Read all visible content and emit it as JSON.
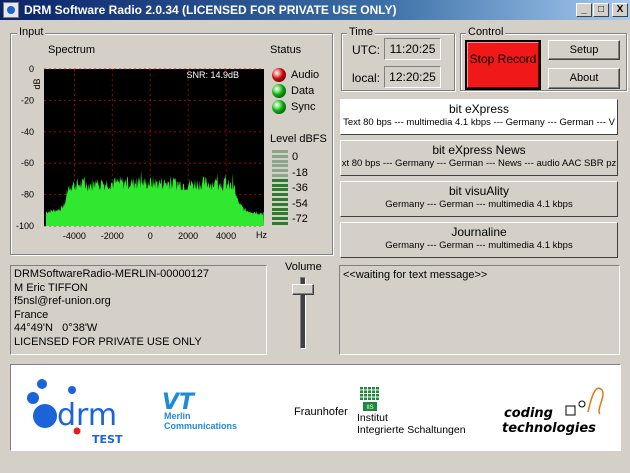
{
  "window": {
    "title": "DRM Software Radio 2.0.34 (LICENSED FOR PRIVATE USE ONLY)",
    "controls": [
      "_",
      "□",
      "X"
    ]
  },
  "input": {
    "group_label": "Input",
    "spectrum_label": "Spectrum",
    "snr_text": "SNR: 14.9dB",
    "y_unit": "dB",
    "y_ticks": [
      "0",
      "-20",
      "-40",
      "-60",
      "-80",
      "-100"
    ],
    "x_ticks": [
      "-4000",
      "-2000",
      "0",
      "2000",
      "4000"
    ],
    "x_unit": "Hz",
    "status_label": "Status",
    "status": [
      {
        "label": "Audio",
        "color": "#e01010"
      },
      {
        "label": "Data",
        "color": "#12c012"
      },
      {
        "label": "Sync",
        "color": "#12c012"
      }
    ],
    "level_label": "Level dBFS",
    "level_ticks": [
      "0",
      "-18",
      "-36",
      "-54",
      "-72"
    ]
  },
  "time": {
    "group_label": "Time",
    "utc_label": "UTC:",
    "utc_value": "11:20:25",
    "local_label": "local:",
    "local_value": "12:20:25"
  },
  "control": {
    "group_label": "Control",
    "stop_record": "Stop Record",
    "setup": "Setup",
    "about": "About"
  },
  "services": [
    {
      "name": "bit eXpress",
      "desc": "Text 80 bps --- multimedia 4.1 kbps --- Germany --- German --- V"
    },
    {
      "name": "bit eXpress News",
      "desc": "xt 80 bps --- Germany --- German --- News --- audio AAC SBR pz"
    },
    {
      "name": "bit visuAlity",
      "desc": "Germany --- German --- multimedia 4.1 kbps"
    },
    {
      "name": "Journaline",
      "desc": "Germany --- German --- multimedia 4.1 kbps"
    }
  ],
  "station_info": [
    "DRMSoftwareRadio-MERLIN-00000127",
    "M Eric TIFFON",
    "f5nsl@ref-union.org",
    "France",
    "44°49'N   0°38'W",
    "LICENSED FOR PRIVATE USE ONLY"
  ],
  "volume_label": "Volume",
  "text_message": "<<waiting for text message>>",
  "logos": {
    "drm": "drm",
    "drm_sub": "TEST",
    "vt": "VT",
    "merlin_line1": "Merlin",
    "merlin_line2": "Communications",
    "fraunhofer": "Fraunhofer",
    "iis": "IIS",
    "iis_line1": "Institut",
    "iis_line2": "Integrierte Schaltungen",
    "coding_line1": "coding",
    "coding_line2": "technologies"
  },
  "chart_data": {
    "type": "area",
    "x_unit": "Hz",
    "y_unit": "dB",
    "xlim": [
      -5600,
      6000
    ],
    "ylim": [
      -100,
      0
    ],
    "x": [
      -5500,
      -5000,
      -4700,
      -4500,
      -4400,
      -4300,
      -4000,
      -3000,
      -2000,
      -1000,
      0,
      1000,
      2000,
      3000,
      4000,
      4400,
      4500,
      4700,
      5000,
      5500,
      6000
    ],
    "y": [
      -91,
      -90,
      -89,
      -86,
      -80,
      -76,
      -75,
      -75,
      -74,
      -74,
      -74,
      -74,
      -75,
      -74,
      -75,
      -77,
      -80,
      -86,
      -90,
      -91,
      -92
    ]
  }
}
